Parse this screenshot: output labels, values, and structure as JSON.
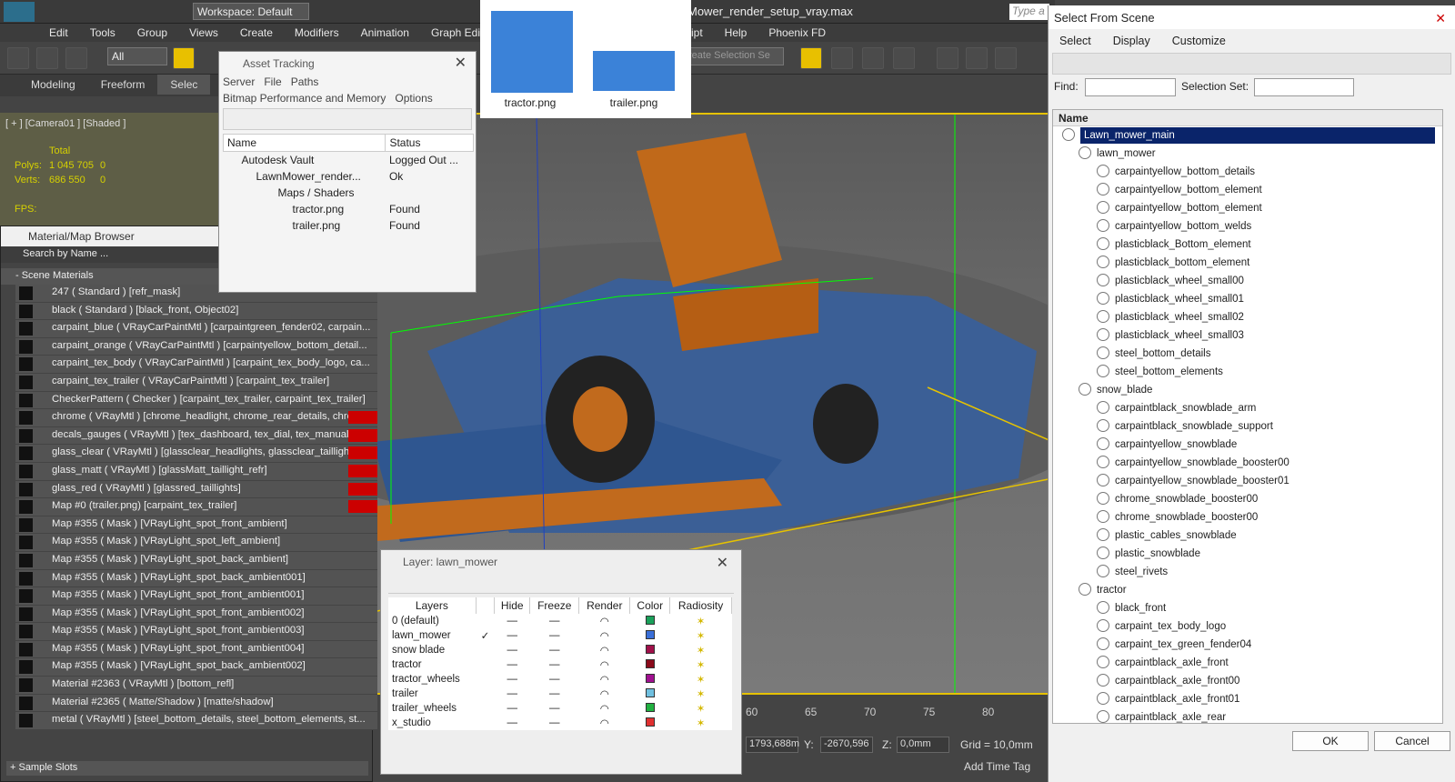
{
  "topbar": {
    "workspace": "Workspace: Default",
    "file_title": "Mower_render_setup_vray.max",
    "search_placeholder": "Type a"
  },
  "menu": [
    "Edit",
    "Tools",
    "Group",
    "Views",
    "Create",
    "Modifiers",
    "Animation",
    "Graph Edi",
    "Script",
    "Help",
    "Phoenix FD"
  ],
  "ribbon": {
    "tabs": [
      "Modeling",
      "Freeform",
      "Selec"
    ]
  },
  "toolbar": {
    "filter": "All",
    "selection_set": "reate Selection Se"
  },
  "viewport": {
    "label": "[ + ] [Camera01 ] [Shaded ]",
    "stats_total": "Total",
    "polys_label": "Polys:",
    "polys_value": "1 045 705",
    "polys_sel": "0",
    "verts_label": "Verts:",
    "verts_value": "686 550",
    "verts_sel": "0",
    "fps": "FPS:"
  },
  "asset": {
    "title": "Asset Tracking",
    "menus": [
      "Server",
      "File",
      "Paths"
    ],
    "menus2": [
      "Bitmap Performance and Memory",
      "Options"
    ],
    "cols": [
      "Name",
      "Status"
    ],
    "rows": [
      {
        "name": "Autodesk Vault",
        "status": "Logged Out ..."
      },
      {
        "name": "LawnMower_render...",
        "status": "Ok"
      },
      {
        "name": "Maps / Shaders",
        "status": ""
      },
      {
        "name": "tractor.png",
        "status": "Found"
      },
      {
        "name": "trailer.png",
        "status": "Found"
      }
    ]
  },
  "thumbs": [
    {
      "label": "tractor.png"
    },
    {
      "label": "trailer.png"
    }
  ],
  "matbrowser": {
    "title": "Material/Map Browser",
    "search": "Search by Name ...",
    "section": "- Scene Materials",
    "sample": "+ Sample Slots",
    "rows": [
      "247  ( Standard ) [refr_mask]",
      "black  ( Standard ) [black_front, Object02]",
      "carpaint_blue  ( VRayCarPaintMtl ) [carpaintgreen_fender02, carpain...",
      "carpaint_orange  ( VRayCarPaintMtl ) [carpaintyellow_bottom_detail...",
      "carpaint_tex_body  ( VRayCarPaintMtl ) [carpaint_tex_body_logo, ca...",
      "carpaint_tex_trailer  ( VRayCarPaintMtl ) [carpaint_tex_trailer]",
      "CheckerPattern  ( Checker ) [carpaint_tex_trailer, carpaint_tex_trailer]",
      "chrome  ( VRayMtl ) [chrome_headlight, chrome_rear_details, chro...",
      "decals_gauges  ( VRayMtl ) [tex_dashboard, tex_dial, tex_manual]",
      "glass_clear ( VRayMtl ) [glassclear_headlights, glassclear_taillight...",
      "glass_matt  ( VRayMtl ) [glassMatt_taillight_refr]",
      "glass_red ( VRayMtl ) [glassred_taillights]",
      "Map #0 (trailer.png)  [carpaint_tex_trailer]",
      "Map #355  ( Mask ) [VRayLight_spot_front_ambient]",
      "Map #355  ( Mask ) [VRayLight_spot_left_ambient]",
      "Map #355  ( Mask ) [VRayLight_spot_back_ambient]",
      "Map #355  ( Mask ) [VRayLight_spot_back_ambient001]",
      "Map #355  ( Mask ) [VRayLight_spot_front_ambient001]",
      "Map #355  ( Mask ) [VRayLight_spot_front_ambient002]",
      "Map #355  ( Mask ) [VRayLight_spot_front_ambient003]",
      "Map #355  ( Mask ) [VRayLight_spot_front_ambient004]",
      "Map #355  ( Mask ) [VRayLight_spot_back_ambient002]",
      "Material #2363  ( VRayMtl ) [bottom_refl]",
      "Material #2365  ( Matte/Shadow ) [matte/shadow]",
      "metal  ( VRayMtl ) [steel_bottom_details, steel_bottom_elements, st..."
    ]
  },
  "layer": {
    "title": "Layer: lawn_mower",
    "cols": [
      "Layers",
      "",
      "Hide",
      "Freeze",
      "Render",
      "Color",
      "Radiosity"
    ],
    "rows": [
      {
        "name": "0 (default)",
        "color": "#1aa05a",
        "check": ""
      },
      {
        "name": "lawn_mower",
        "color": "#3a6fd8",
        "check": "✓"
      },
      {
        "name": "snow blade",
        "color": "#a0104a",
        "check": ""
      },
      {
        "name": "tractor",
        "color": "#8a0a1a",
        "check": ""
      },
      {
        "name": "tractor_wheels",
        "color": "#a01090",
        "check": ""
      },
      {
        "name": "trailer",
        "color": "#70c0e0",
        "check": ""
      },
      {
        "name": "trailer_wheels",
        "color": "#20b040",
        "check": ""
      },
      {
        "name": "x_studio",
        "color": "#e03030",
        "check": ""
      }
    ]
  },
  "scene": {
    "title": "Select From Scene",
    "menus": [
      "Select",
      "Display",
      "Customize"
    ],
    "find": "Find:",
    "selset": "Selection Set:",
    "col": "Name",
    "ok": "OK",
    "cancel": "Cancel",
    "rows": [
      {
        "label": "Lawn_mower_main",
        "lvl": 0,
        "sel": true
      },
      {
        "label": "lawn_mower",
        "lvl": 1
      },
      {
        "label": "carpaintyellow_bottom_details",
        "lvl": 2
      },
      {
        "label": "carpaintyellow_bottom_element",
        "lvl": 2
      },
      {
        "label": "carpaintyellow_bottom_element",
        "lvl": 2
      },
      {
        "label": "carpaintyellow_bottom_welds",
        "lvl": 2
      },
      {
        "label": "plasticblack_Bottom_element",
        "lvl": 2
      },
      {
        "label": "plasticblack_bottom_element",
        "lvl": 2
      },
      {
        "label": "plasticblack_wheel_small00",
        "lvl": 2
      },
      {
        "label": "plasticblack_wheel_small01",
        "lvl": 2
      },
      {
        "label": "plasticblack_wheel_small02",
        "lvl": 2
      },
      {
        "label": "plasticblack_wheel_small03",
        "lvl": 2
      },
      {
        "label": "steel_bottom_details",
        "lvl": 2
      },
      {
        "label": "steel_bottom_elements",
        "lvl": 2
      },
      {
        "label": "snow_blade",
        "lvl": 1
      },
      {
        "label": "carpaintblack_snowblade_arm",
        "lvl": 2
      },
      {
        "label": "carpaintblack_snowblade_support",
        "lvl": 2
      },
      {
        "label": "carpaintyellow_snowblade",
        "lvl": 2
      },
      {
        "label": "carpaintyellow_snowblade_booster00",
        "lvl": 2
      },
      {
        "label": "carpaintyellow_snowblade_booster01",
        "lvl": 2
      },
      {
        "label": "chrome_snowblade_booster00",
        "lvl": 2
      },
      {
        "label": "chrome_snowblade_booster00",
        "lvl": 2
      },
      {
        "label": "plastic_cables_snowblade",
        "lvl": 2
      },
      {
        "label": "plastic_snowblade",
        "lvl": 2
      },
      {
        "label": "steel_rivets",
        "lvl": 2
      },
      {
        "label": "tractor",
        "lvl": 1
      },
      {
        "label": "black_front",
        "lvl": 2
      },
      {
        "label": "carpaint_tex_body_logo",
        "lvl": 2
      },
      {
        "label": "carpaint_tex_green_fender04",
        "lvl": 2
      },
      {
        "label": "carpaintblack_axle_front",
        "lvl": 2
      },
      {
        "label": "carpaintblack_axle_front00",
        "lvl": 2
      },
      {
        "label": "carpaintblack_axle_front01",
        "lvl": 2
      },
      {
        "label": "carpaintblack_axle_rear",
        "lvl": 2
      }
    ]
  },
  "status": {
    "ruler": [
      "60",
      "65",
      "70",
      "75",
      "80"
    ],
    "x": "1793,688m",
    "y_label": "Y:",
    "y": "-2670,596",
    "z_label": "Z:",
    "z": "0,0mm",
    "grid": "Grid = 10,0mm",
    "timetag": "Add Time Tag"
  }
}
